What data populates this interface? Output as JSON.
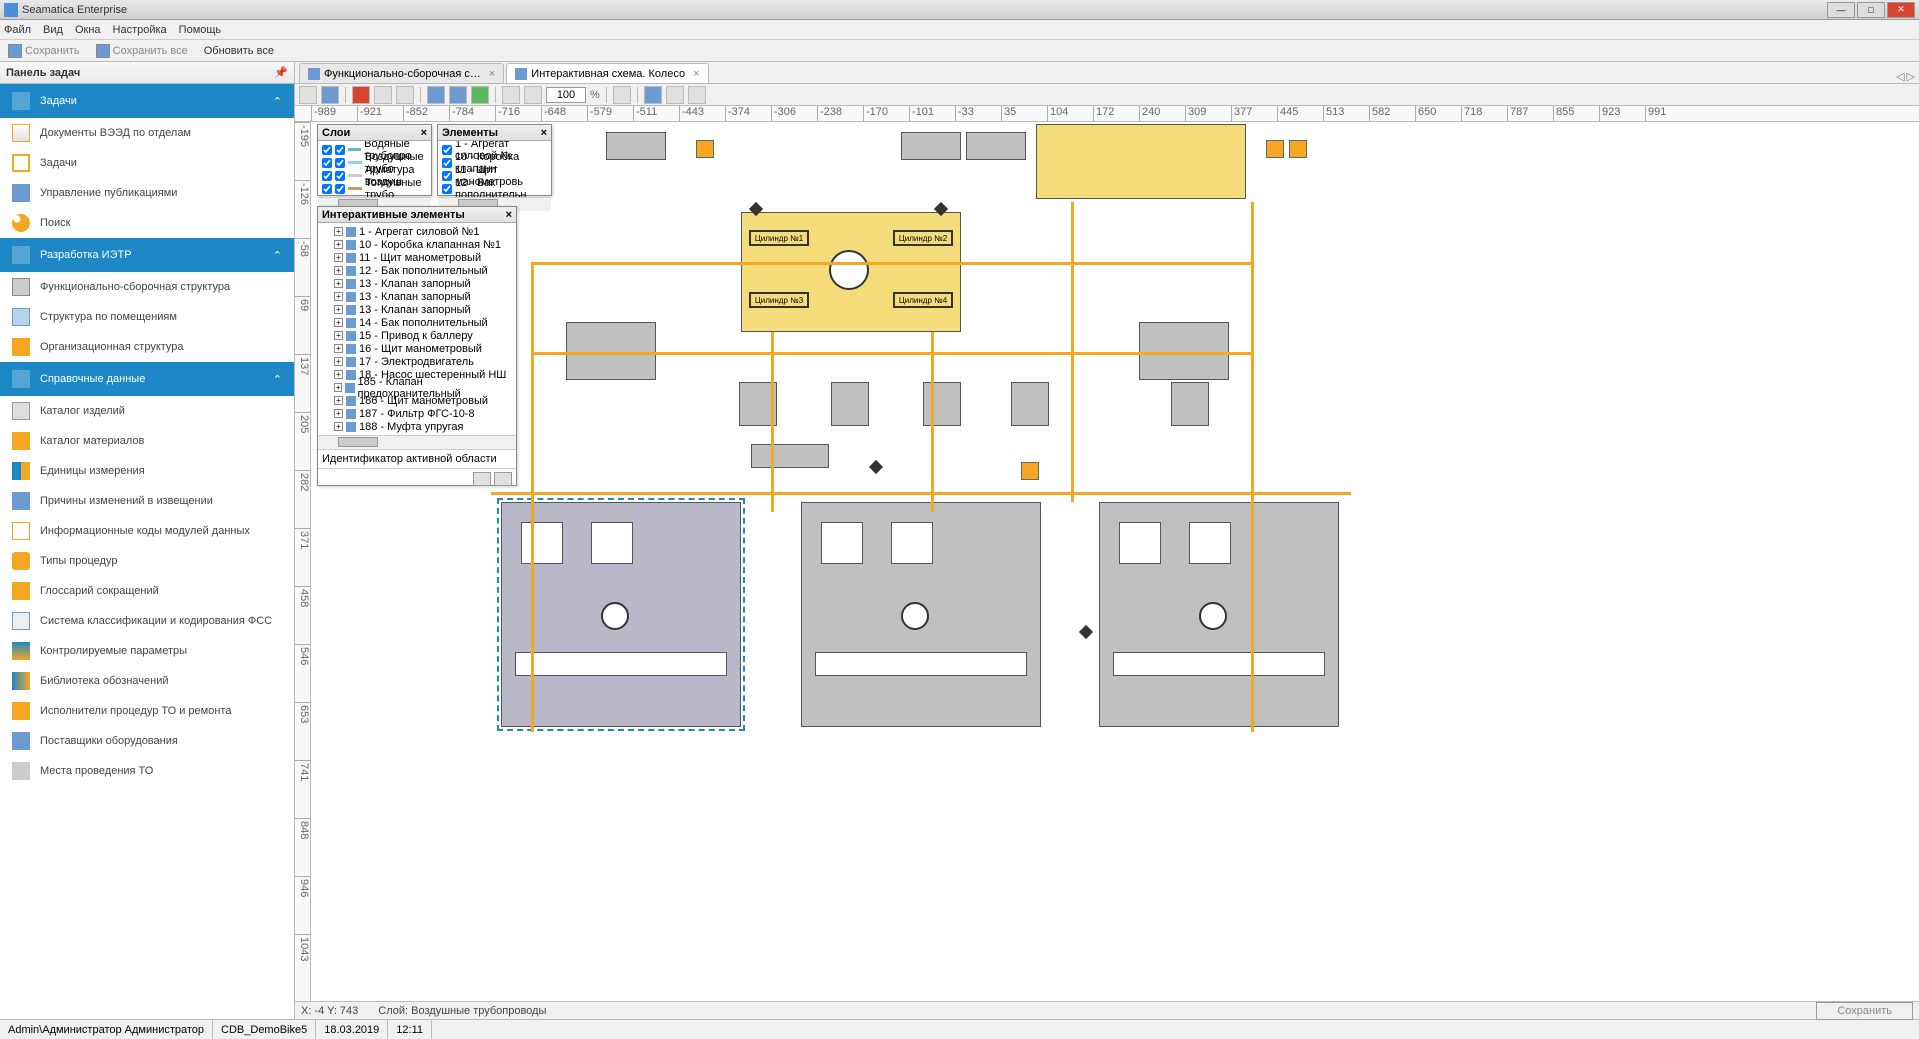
{
  "window": {
    "title": "Seamatica Enterprise"
  },
  "menu": [
    "Файл",
    "Вид",
    "Окна",
    "Настройка",
    "Помощь"
  ],
  "toolbar": {
    "save": "Сохранить",
    "save_all": "Сохранить все",
    "refresh_all": "Обновить все"
  },
  "sidebar": {
    "title": "Панель задач",
    "sections": [
      {
        "label": "Задачи",
        "items": [
          {
            "label": "Документы ВЭЭД по отделам",
            "icon": "ico-doc"
          },
          {
            "label": "Задачи",
            "icon": "ico-task"
          },
          {
            "label": "Управление публикациями",
            "icon": "ico-pub"
          },
          {
            "label": "Поиск",
            "icon": "ico-search"
          }
        ]
      },
      {
        "label": "Разработка ИЭТР",
        "items": [
          {
            "label": "Функционально-сборочная структура",
            "icon": "ico-struct"
          },
          {
            "label": "Структура по помещениям",
            "icon": "ico-room"
          },
          {
            "label": "Организационная структура",
            "icon": "ico-org"
          }
        ]
      },
      {
        "label": "Справочные данные",
        "items": [
          {
            "label": "Каталог изделий",
            "icon": "ico-cat"
          },
          {
            "label": "Каталог материалов",
            "icon": "ico-mat"
          },
          {
            "label": "Единицы измерения",
            "icon": "ico-unit"
          },
          {
            "label": "Причины изменений в извещении",
            "icon": "ico-reason"
          },
          {
            "label": "Информационные коды модулей данных",
            "icon": "ico-info"
          },
          {
            "label": "Типы процедур",
            "icon": "ico-proc"
          },
          {
            "label": "Глоссарий сокращений",
            "icon": "ico-gloss"
          },
          {
            "label": "Система классификации и кодирования ФСС",
            "icon": "ico-class"
          },
          {
            "label": "Контролируемые параметры",
            "icon": "ico-param"
          },
          {
            "label": "Библиотека обозначений",
            "icon": "ico-lib"
          },
          {
            "label": "Исполнители процедур ТО и ремонта",
            "icon": "ico-perf"
          },
          {
            "label": "Поставщики оборудования",
            "icon": "ico-sup"
          },
          {
            "label": "Места проведения ТО",
            "icon": "ico-loc"
          }
        ]
      }
    ]
  },
  "tabs": [
    {
      "label": "Функционально-сборочная с…",
      "active": false
    },
    {
      "label": "Интерактивная схема. Колесо",
      "active": true
    }
  ],
  "canvas_toolbar": {
    "zoom": "100"
  },
  "ruler_h": [
    "-989",
    "-921",
    "-852",
    "-784",
    "-716",
    "-648",
    "-579",
    "-511",
    "-443",
    "-374",
    "-306",
    "-238",
    "-170",
    "-101",
    "-33",
    "35",
    "104",
    "172",
    "240",
    "309",
    "377",
    "445",
    "513",
    "582",
    "650",
    "718",
    "787",
    "855",
    "923",
    "991"
  ],
  "ruler_v": [
    "-195",
    "-126",
    "-58",
    "69",
    "137",
    "205",
    "282",
    "371",
    "458",
    "546",
    "653",
    "741",
    "848",
    "946",
    "1043"
  ],
  "panels": {
    "layers": {
      "title": "Слои",
      "items": [
        "Водяные трубопро",
        "Воздушные трубо",
        "Арматура воздуш",
        "Топливные трубо"
      ]
    },
    "elements": {
      "title": "Элементы",
      "items": [
        "1 - Агрегат силовой №",
        "10 - Коробка клапанн",
        "11 - Щит манометровь",
        "12 - Бак пополнительн"
      ]
    },
    "interactive": {
      "title": "Интерактивные элементы",
      "items": [
        "1 - Агрегат силовой №1",
        "10 - Коробка клапанная №1",
        "11 - Щит манометровый",
        "12 - Бак пополнительный",
        "13 - Клапан запорный",
        "13 - Клапан запорный",
        "13 - Клапан запорный",
        "14 - Бак пополнительный",
        "15 - Привод к баллеру",
        "16 - Щит манометровый",
        "17 - Электродвигатель",
        "18 - Насос шестеренный НШ",
        "185 - Клапан предохранительный",
        "186 - Щит манометровый",
        "187 - Фильтр ФГС-10-8",
        "188 - Муфта упругая"
      ],
      "footer": "Идентификатор активной области"
    }
  },
  "schematic": {
    "cylinders": [
      "Цилиндр №1",
      "Цилиндр №2",
      "Цилиндр №3",
      "Цилиндр №4"
    ]
  },
  "canvas_status": {
    "coords": "X: -4 Y: 743",
    "layer": "Слой: Воздушные трубопроводы",
    "save": "Сохранить"
  },
  "status": {
    "user": "Admin\\Администратор Администратор",
    "db": "CDB_DemoBike5",
    "date": "18.03.2019",
    "time": "12:11"
  }
}
